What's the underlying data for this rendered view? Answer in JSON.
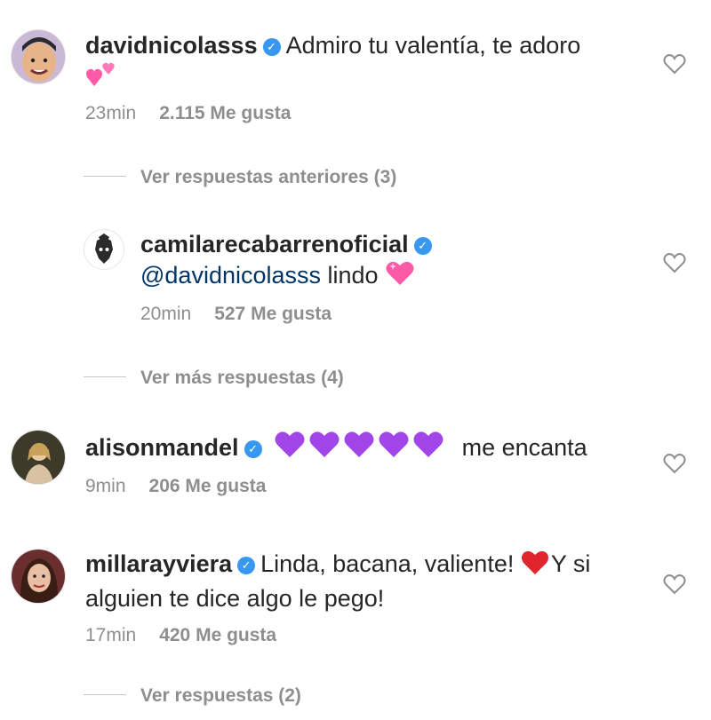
{
  "comments": [
    {
      "user": "davidnicolasss",
      "text": "Admiro tu valentía, te adoro",
      "time": "23min",
      "likes": "2.115 Me gusta"
    },
    {
      "user": "camilarecabarrenoficial",
      "mention": "@davidnicolasss",
      "text": "lindo",
      "time": "20min",
      "likes": "527 Me gusta"
    },
    {
      "user": "alisonmandel",
      "text": "me encanta",
      "time": "9min",
      "likes": "206 Me gusta"
    },
    {
      "user": "millarayviera",
      "text": "Linda, bacana, valiente!",
      "text2": "Y si",
      "text_line2": "alguien te dice algo le pego!",
      "time": "17min",
      "likes": "420 Me gusta"
    }
  ],
  "view_replies": [
    "Ver respuestas anteriores (3)",
    "Ver más respuestas (4)",
    "Ver respuestas (2)"
  ],
  "icons": {
    "verified": "verified-badge-icon",
    "like": "heart-outline-icon"
  },
  "colors": {
    "verified": "#3897f0",
    "mention": "#003569",
    "meta": "#8e8e8e",
    "purple_heart": "#a245e8",
    "red_heart": "#e0252e",
    "pink_heart": "#ff5aa8"
  }
}
